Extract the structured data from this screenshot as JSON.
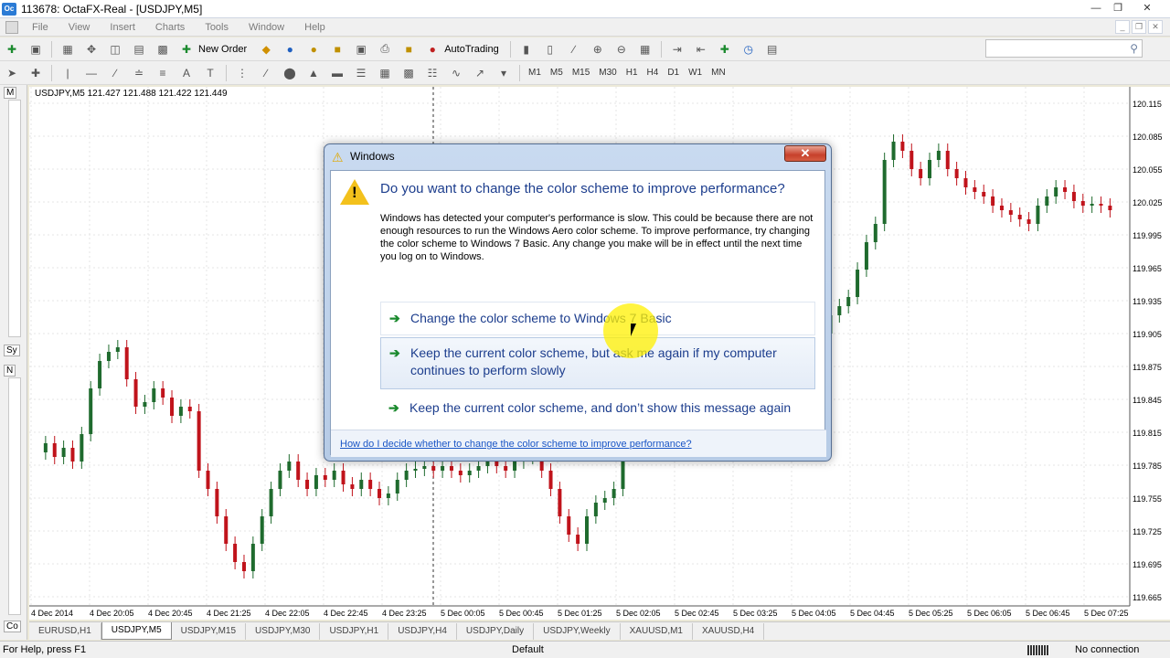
{
  "window": {
    "title": "113678: OctaFX-Real - [USDJPY,M5]",
    "app_icon": "Oc"
  },
  "menu": [
    "File",
    "View",
    "Insert",
    "Charts",
    "Tools",
    "Window",
    "Help"
  ],
  "toolbar": {
    "new_order": "New Order",
    "autotrading": "AutoTrading"
  },
  "timeframes": [
    "M1",
    "M5",
    "M15",
    "M30",
    "H1",
    "H4",
    "D1",
    "W1",
    "MN"
  ],
  "left_panel": {
    "label_top": "Sy",
    "label_mid": "N",
    "label_bot": "Co",
    "label_top2": "M"
  },
  "chart": {
    "info": "USDJPY,M5  121.427 121.488 121.422 121.449",
    "prices": [
      "120.115",
      "120.085",
      "120.055",
      "120.025",
      "119.995",
      "119.965",
      "119.935",
      "119.905",
      "119.875",
      "119.845",
      "119.815",
      "119.785",
      "119.755",
      "119.725",
      "119.695",
      "119.665"
    ],
    "times": [
      "4 Dec 2014",
      "4 Dec 20:05",
      "4 Dec 20:45",
      "4 Dec 21:25",
      "4 Dec 22:05",
      "4 Dec 22:45",
      "4 Dec 23:25",
      "5 Dec 00:05",
      "5 Dec 00:45",
      "5 Dec 01:25",
      "5 Dec 02:05",
      "5 Dec 02:45",
      "5 Dec 03:25",
      "5 Dec 04:05",
      "5 Dec 04:45",
      "5 Dec 05:25",
      "5 Dec 06:05",
      "5 Dec 06:45",
      "5 Dec 07:25"
    ],
    "up_color": "#1f6b2e",
    "down_color": "#c0131b"
  },
  "tabs": [
    "EURUSD,H1",
    "USDJPY,M5",
    "USDJPY,M15",
    "USDJPY,M30",
    "USDJPY,H1",
    "USDJPY,H4",
    "USDJPY,Daily",
    "USDJPY,Weekly",
    "XAUUSD,M1",
    "XAUUSD,H4"
  ],
  "active_tab": "USDJPY,M5",
  "status": {
    "help": "For Help, press F1",
    "profile": "Default",
    "connection": "No connection"
  },
  "dialog": {
    "title": "Windows",
    "close": "✕",
    "heading": "Do you want to change the color scheme to improve performance?",
    "body": "Windows has detected your computer's performance is slow. This could be because there are not enough resources to run the Windows Aero color scheme. To improve performance, try changing the color scheme to Windows 7 Basic. Any change you make will be in effect until the next time you log on to Windows.",
    "option1": "Change the color scheme to Windows 7 Basic",
    "option2": "Keep the current color scheme, but ask me again if my computer continues to perform slowly",
    "option3": "Keep the current color scheme, and don’t show this message again",
    "link": "How do I decide whether to change the color scheme to improve performance?"
  }
}
